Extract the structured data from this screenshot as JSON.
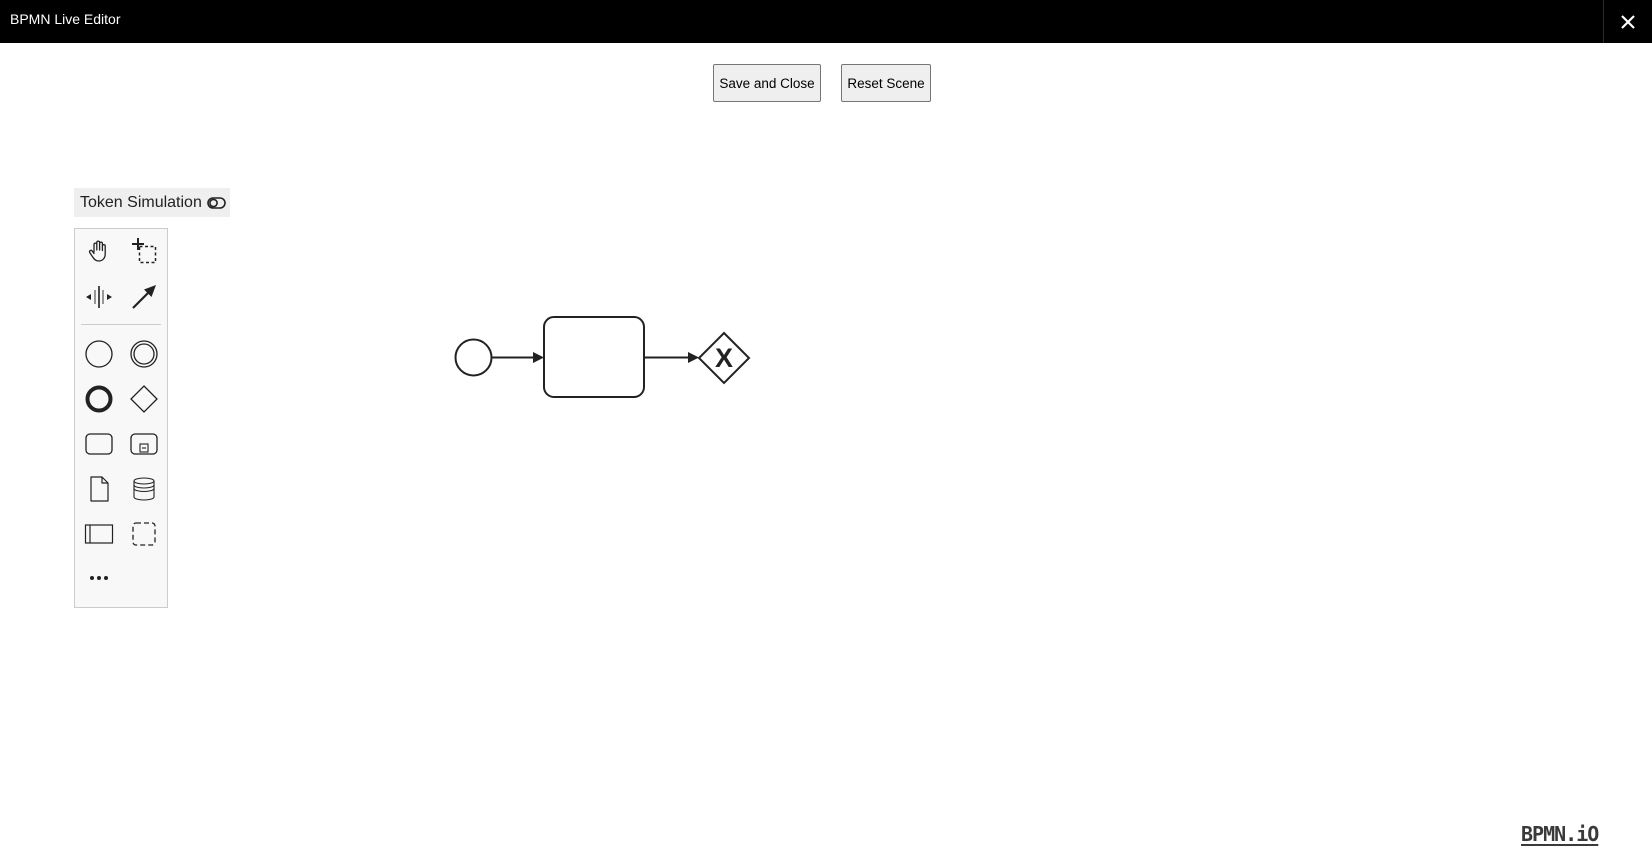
{
  "window": {
    "title": "BPMN Live Editor",
    "close_icon": "close-icon"
  },
  "toolbar": {
    "save_label": "Save and Close",
    "reset_label": "Reset Scene"
  },
  "token_simulation": {
    "label": "Token Simulation",
    "toggle_icon": "toggle-icon"
  },
  "palette": {
    "tools": [
      "hand-tool-icon",
      "lasso-tool-icon",
      "space-tool-icon",
      "global-connect-tool-icon",
      "start-event-icon",
      "intermediate-event-icon",
      "end-event-icon",
      "gateway-icon",
      "task-icon",
      "subprocess-icon",
      "data-object-icon",
      "data-store-icon",
      "participant-icon",
      "group-icon",
      "more-icon"
    ]
  },
  "diagram": {
    "elements": [
      "start-event",
      "task",
      "exclusive-gateway"
    ],
    "gateway_marker": "X",
    "stroke_color": "#222222"
  },
  "footer": {
    "logo_text": "BPMN.iO"
  }
}
